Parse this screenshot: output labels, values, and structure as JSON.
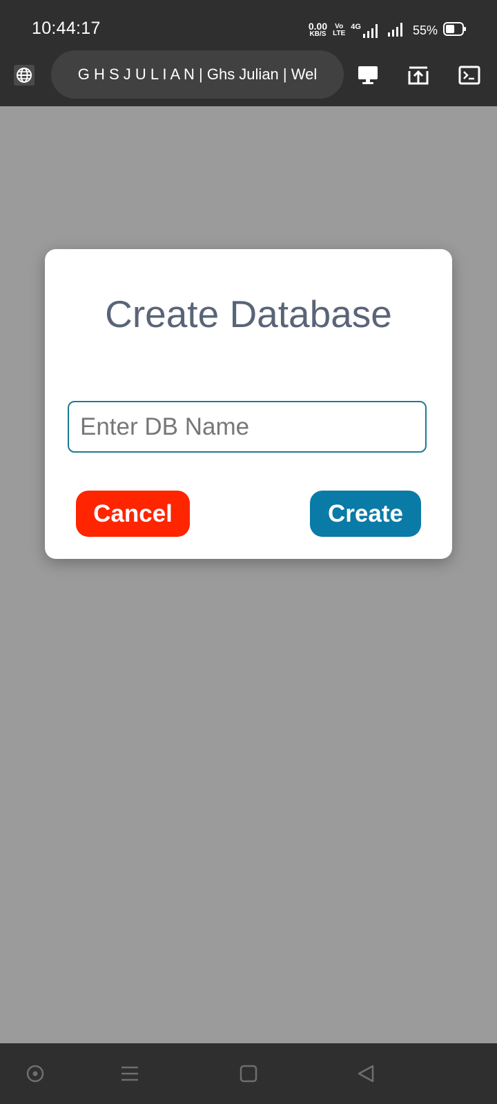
{
  "status_bar": {
    "time": "10:44:17",
    "net_speed_value": "0.00",
    "net_speed_unit": "KB/S",
    "volte_top": "Vo",
    "volte_bottom": "LTE",
    "network_type": "4G",
    "battery_percent": "55%",
    "battery_level": 0.55,
    "icons": [
      "volte-icon",
      "signal-4g-icon",
      "signal-icon",
      "battery-icon"
    ]
  },
  "browser_bar": {
    "page_title": "G H S J U L I A N | Ghs Julian | Wel",
    "icons": [
      "globe-icon",
      "desktop-icon",
      "upload-icon",
      "terminal-icon"
    ]
  },
  "dialog": {
    "title": "Create Database",
    "input_placeholder": "Enter DB Name",
    "input_value": "",
    "cancel_label": "Cancel",
    "create_label": "Create"
  },
  "nav_bar": {
    "icons": [
      "circle-dot-icon",
      "menu-icon",
      "home-square-icon",
      "back-icon"
    ]
  },
  "colors": {
    "overlay": "#9b9b9b",
    "bars": "#2f2f2f",
    "url_pill": "#414141",
    "dialog_title": "#5a6478",
    "input_border": "#1a7a91",
    "cancel": "#fe2500",
    "create": "#0a7ba6"
  }
}
